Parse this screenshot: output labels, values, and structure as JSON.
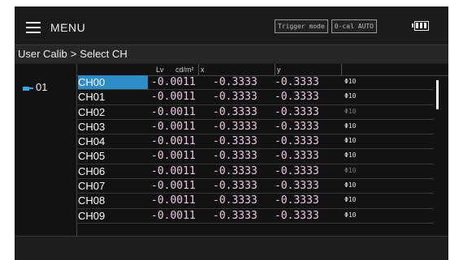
{
  "menu": {
    "label": "MENU"
  },
  "status": {
    "trigger_mode": "Trigger mode",
    "zero_cal": "0-cal AUTO"
  },
  "breadcrumb": {
    "root": "User Calib",
    "current": "Select CH",
    "separator": ">"
  },
  "group": {
    "label": "01",
    "icon": "probe-plug-icon"
  },
  "columns": {
    "lv": "Lv",
    "unit": "cd/m²",
    "x": "x",
    "y": "y"
  },
  "channels": [
    {
      "name": "CH00",
      "lv": "-0.0011",
      "x": "-0.3333",
      "y": "-0.3333",
      "probe": "Φ10",
      "active": true,
      "selected": true
    },
    {
      "name": "CH01",
      "lv": "-0.0011",
      "x": "-0.3333",
      "y": "-0.3333",
      "probe": "Φ10",
      "active": true,
      "selected": false
    },
    {
      "name": "CH02",
      "lv": "-0.0011",
      "x": "-0.3333",
      "y": "-0.3333",
      "probe": "Φ10",
      "active": false,
      "selected": false
    },
    {
      "name": "CH03",
      "lv": "-0.0011",
      "x": "-0.3333",
      "y": "-0.3333",
      "probe": "Φ10",
      "active": true,
      "selected": false
    },
    {
      "name": "CH04",
      "lv": "-0.0011",
      "x": "-0.3333",
      "y": "-0.3333",
      "probe": "Φ10",
      "active": true,
      "selected": false
    },
    {
      "name": "CH05",
      "lv": "-0.0011",
      "x": "-0.3333",
      "y": "-0.3333",
      "probe": "Φ10",
      "active": true,
      "selected": false
    },
    {
      "name": "CH06",
      "lv": "-0.0011",
      "x": "-0.3333",
      "y": "-0.3333",
      "probe": "Φ10",
      "active": false,
      "selected": false
    },
    {
      "name": "CH07",
      "lv": "-0.0011",
      "x": "-0.3333",
      "y": "-0.3333",
      "probe": "Φ10",
      "active": true,
      "selected": false
    },
    {
      "name": "CH08",
      "lv": "-0.0011",
      "x": "-0.3333",
      "y": "-0.3333",
      "probe": "Φ10",
      "active": true,
      "selected": false
    },
    {
      "name": "CH09",
      "lv": "-0.0011",
      "x": "-0.3333",
      "y": "-0.3333",
      "probe": "Φ10",
      "active": true,
      "selected": false
    }
  ],
  "colors": {
    "selection": "#2c8cc6",
    "value_text": "#e9c9e2",
    "probe_icon": "#2fa9e0"
  }
}
